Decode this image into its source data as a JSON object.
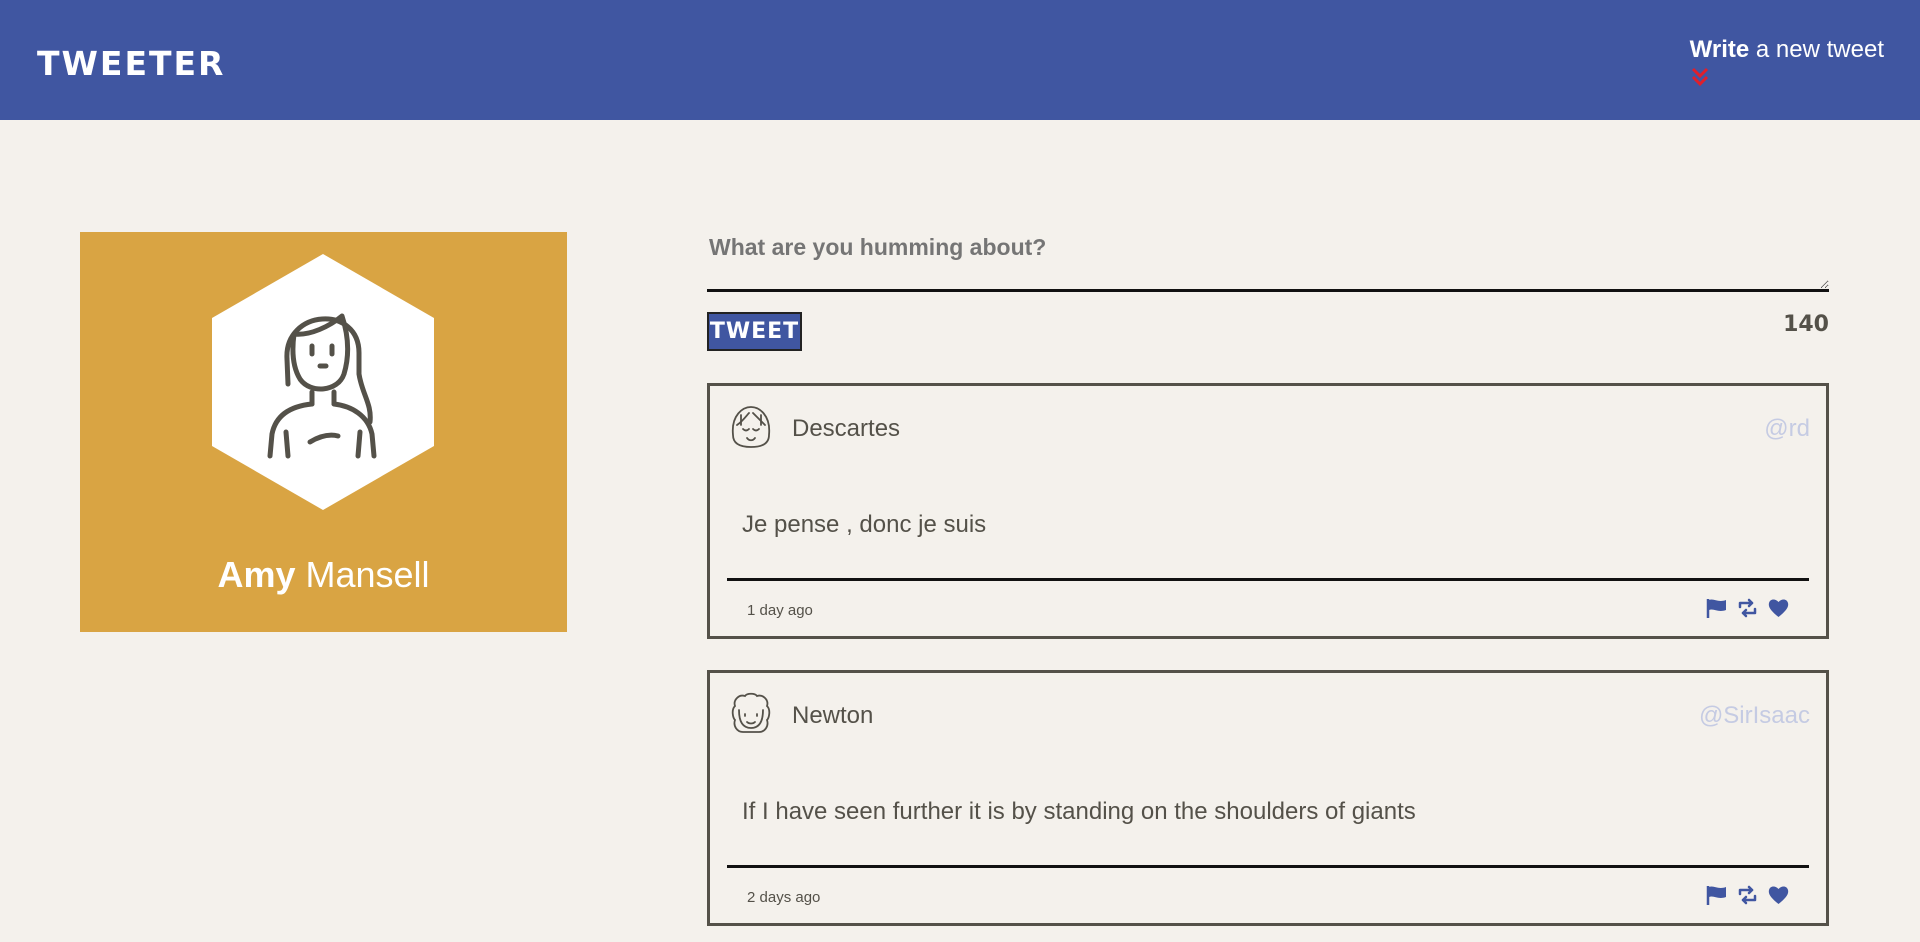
{
  "nav": {
    "logo": "TWEETER",
    "compose_bold": "Write",
    "compose_rest": " a new tweet",
    "chevron_color": "#e01f2b",
    "background": "#4056a1"
  },
  "profile": {
    "first_name": "Amy",
    "last_name": " Mansell",
    "avatar_icon": "woman-avatar-icon",
    "background": "#d9a443"
  },
  "composer": {
    "placeholder": "What are you humming about?",
    "button_label": "TWEET",
    "char_counter": "140"
  },
  "tweets": [
    {
      "author": "Descartes",
      "handle": "@rd",
      "content": "Je pense , donc je suis",
      "age": "1 day ago",
      "avatar_icon": "descartes-avatar-icon"
    },
    {
      "author": "Newton",
      "handle": "@SirIsaac",
      "content": "If I have seen further it is by standing on the shoulders of giants",
      "age": "2 days ago",
      "avatar_icon": "newton-avatar-icon"
    }
  ],
  "colors": {
    "accent": "#4056a1",
    "handle": "#c5cbe3",
    "text": "#545149",
    "page": "#f4f1ec"
  }
}
